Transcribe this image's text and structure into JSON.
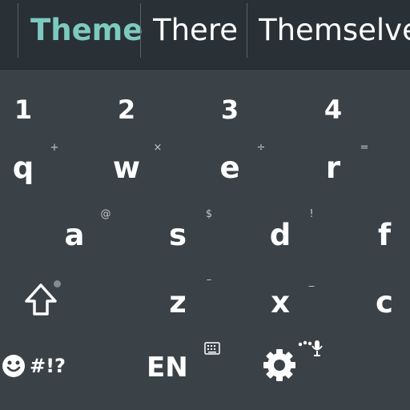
{
  "suggestions": {
    "primary": "Theme",
    "second": "There",
    "third": "Themselves"
  },
  "number_row": [
    "1",
    "2",
    "3",
    "4"
  ],
  "row_q": {
    "keys": [
      "q",
      "w",
      "e",
      "r"
    ],
    "hints": [
      "+",
      "×",
      "÷",
      "="
    ]
  },
  "row_a": {
    "keys": [
      "a",
      "s",
      "d",
      "f"
    ],
    "hints": [
      "@",
      "$",
      "!"
    ]
  },
  "row_z": {
    "keys": [
      "z",
      "x",
      "c"
    ],
    "hints": [
      "–",
      "_"
    ]
  },
  "bottom": {
    "symbols_label": "#!?",
    "language_label": "EN"
  },
  "colors": {
    "accent": "#7dc9c0",
    "keyboard_bg": "#3a4248",
    "suggestion_bg": "#293136"
  },
  "icons": [
    "smiley-icon",
    "keyboard-icon",
    "gear-icon",
    "microphone-icon",
    "shift-arrow-icon"
  ]
}
